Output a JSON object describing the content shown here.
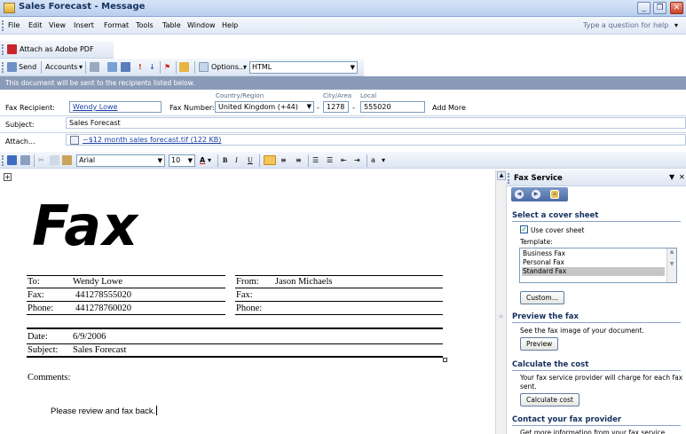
{
  "window": {
    "title": "Sales Forecast - Message"
  },
  "menu": {
    "items": [
      "File",
      "Edit",
      "View",
      "Insert",
      "Format",
      "Tools",
      "Table",
      "Window",
      "Help"
    ],
    "help_placeholder": "Type a question for help"
  },
  "pdf_toolbar": {
    "label": "Attach as Adobe PDF"
  },
  "send_toolbar": {
    "send": "Send",
    "accounts": "Accounts",
    "options": "Options...",
    "format": "HTML"
  },
  "info_bar": "This document will be sent to the recipients listed below.",
  "header": {
    "fax_recipient_label": "Fax Recipient:",
    "fax_recipient": "Wendy Lowe",
    "fax_number_label": "Fax Number:",
    "country_label": "Country/Region",
    "country": "United Kingdom (+44)",
    "city_label": "City/Area",
    "city": "1278",
    "local_label": "Local",
    "local": "555020",
    "add_more": "Add More",
    "subject_label": "Subject:",
    "subject": "Sales Forecast",
    "attach_label": "Attach...",
    "attachment": "~$12 month sales forecast.tif (122 KB)"
  },
  "format_toolbar": {
    "font": "Arial",
    "size": "10"
  },
  "document": {
    "logo": "Fax",
    "to_label": "To:",
    "to": "Wendy Lowe",
    "fax_label": "Fax:",
    "fax": "441278555020",
    "phone_label": "Phone:",
    "phone": "441278760020",
    "from_label": "From:",
    "from": "Jason Michaels",
    "from_fax_label": "Fax:",
    "from_phone_label": "Phone:",
    "date_label": "Date:",
    "date": "6/9/2006",
    "subject_label": "Subject:",
    "subject": "Sales Forecast",
    "comments_label": "Comments:",
    "body": "Please review and fax back."
  },
  "pane": {
    "title": "Fax Service",
    "cover_heading": "Select a cover sheet",
    "use_cover": "Use cover sheet",
    "template_label": "Template:",
    "templates": [
      "Business Fax",
      "Personal Fax",
      "Standard Fax"
    ],
    "selected_template": "Standard Fax",
    "custom_button": "Custom...",
    "preview_heading": "Preview the fax",
    "preview_text": "See the fax image of your document.",
    "preview_button": "Preview",
    "cost_heading": "Calculate the cost",
    "cost_text_1": "Your fax service provider will charge for each fax",
    "cost_text_2": "sent.",
    "cost_button": "Calculate cost",
    "contact_heading": "Contact your fax provider",
    "contact_text": "Get more information from your fax service"
  },
  "colors": {
    "title_text": "#14315d",
    "info_bar": "#8a9bb8",
    "accent_link": "#1a3fa8"
  }
}
